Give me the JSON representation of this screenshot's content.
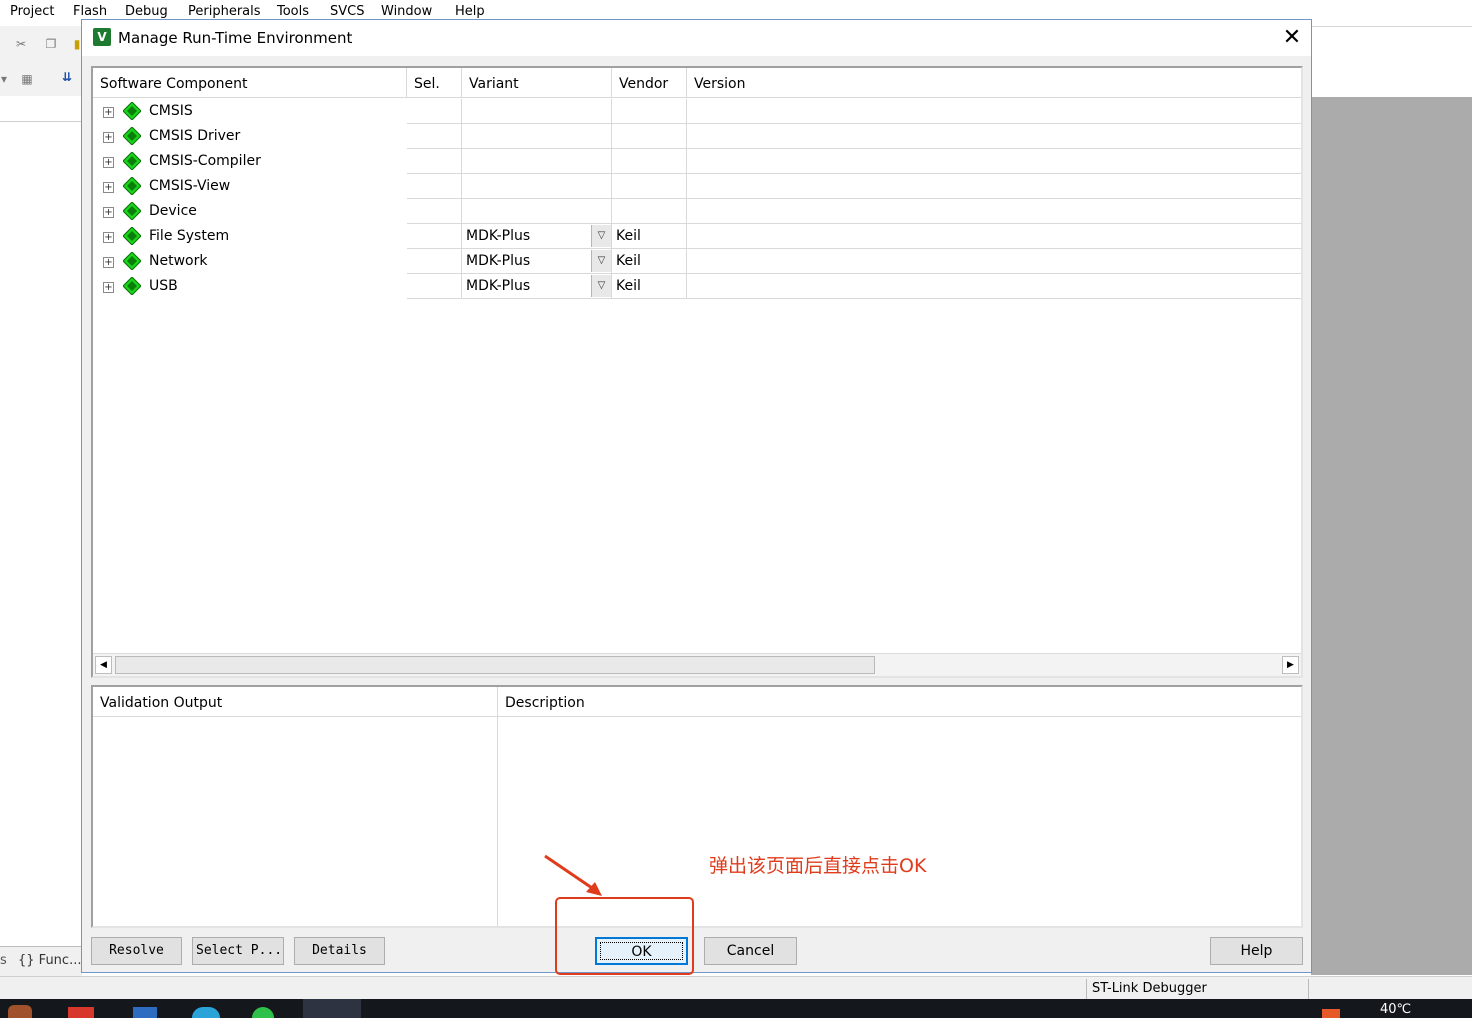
{
  "ide": {
    "menu": [
      "Project",
      "Flash",
      "Debug",
      "Peripherals",
      "Tools",
      "SVCS",
      "Window",
      "Help"
    ],
    "left_tabs_label": "{} Func...",
    "left_tab_prefix": "s",
    "status_debugger": "ST-Link Debugger",
    "tray_temp": "40℃"
  },
  "dialog": {
    "title": "Manage Run-Time Environment",
    "close_glyph": "✕",
    "columns": {
      "component": "Software Component",
      "sel": "Sel.",
      "variant": "Variant",
      "vendor": "Vendor",
      "version": "Version"
    },
    "components": [
      {
        "name": "CMSIS",
        "variant": "",
        "vendor": ""
      },
      {
        "name": "CMSIS Driver",
        "variant": "",
        "vendor": ""
      },
      {
        "name": "CMSIS-Compiler",
        "variant": "",
        "vendor": ""
      },
      {
        "name": "CMSIS-View",
        "variant": "",
        "vendor": ""
      },
      {
        "name": "Device",
        "variant": "",
        "vendor": ""
      },
      {
        "name": "File System",
        "variant": "MDK-Plus",
        "vendor": "Keil"
      },
      {
        "name": "Network",
        "variant": "MDK-Plus",
        "vendor": "Keil"
      },
      {
        "name": "USB",
        "variant": "MDK-Plus",
        "vendor": "Keil"
      }
    ],
    "validation_output": "Validation Output",
    "description": "Description",
    "buttons": {
      "resolve": "Resolve",
      "select_packs": "Select P...",
      "details": "Details",
      "ok": "OK",
      "cancel": "Cancel",
      "help": "Help"
    }
  },
  "annotation": {
    "text": "弹出该页面后直接点击OK",
    "color": "#e03c1c"
  },
  "colors": {
    "accent": "#0078d7",
    "gem_green": "#19d419"
  }
}
